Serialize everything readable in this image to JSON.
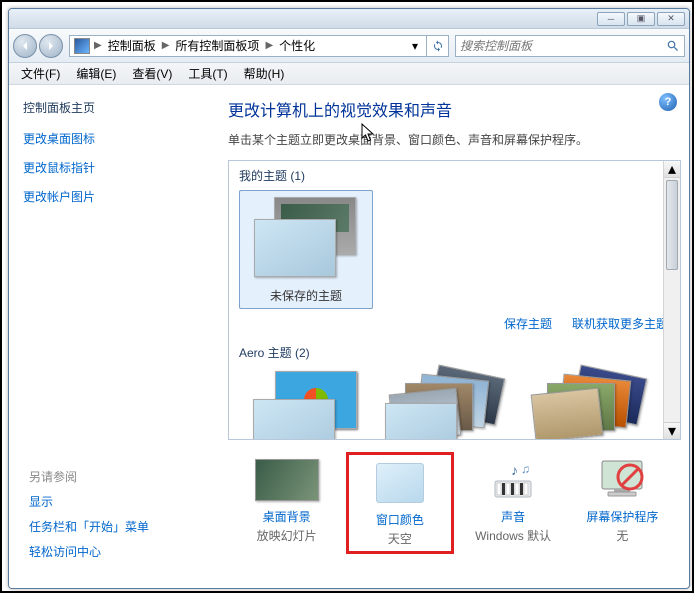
{
  "window_controls": {
    "min": "─",
    "max": "▣",
    "close": "✕"
  },
  "breadcrumbs": [
    "控制面板",
    "所有控制面板项",
    "个性化"
  ],
  "search_placeholder": "搜索控制面板",
  "menubar": [
    "文件(F)",
    "编辑(E)",
    "查看(V)",
    "工具(T)",
    "帮助(H)"
  ],
  "sidebar": {
    "home": "控制面板主页",
    "links": [
      "更改桌面图标",
      "更改鼠标指针",
      "更改帐户图片"
    ],
    "see_also_hdr": "另请参阅",
    "see_also": [
      "显示",
      "任务栏和「开始」菜单",
      "轻松访问中心"
    ]
  },
  "page": {
    "title": "更改计算机上的视觉效果和声音",
    "subtitle": "单击某个主题立即更改桌面背景、窗口颜色、声音和屏幕保护程序。",
    "my_themes_hdr": "我的主题 (1)",
    "unsaved_theme": "未保存的主题",
    "aero_hdr": "Aero 主题 (2)",
    "save_theme": "保存主题",
    "get_more": "联机获取更多主题"
  },
  "options": {
    "bg": {
      "title": "桌面背景",
      "sub": "放映幻灯片"
    },
    "color": {
      "title": "窗口颜色",
      "sub": "天空"
    },
    "sound": {
      "title": "声音",
      "sub": "Windows 默认"
    },
    "saver": {
      "title": "屏幕保护程序",
      "sub": "无"
    }
  }
}
